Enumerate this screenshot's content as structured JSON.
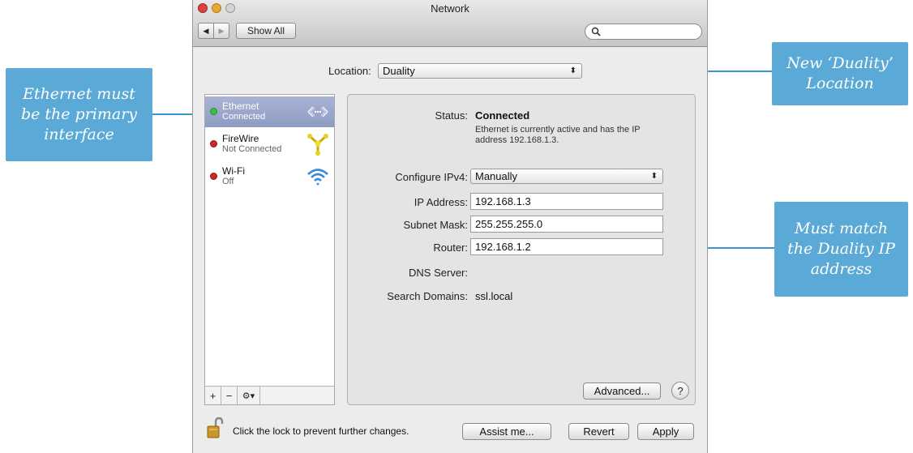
{
  "window": {
    "title": "Network",
    "show_all": "Show All"
  },
  "location": {
    "label": "Location:",
    "value": "Duality"
  },
  "services": [
    {
      "name": "Ethernet",
      "status": "Connected",
      "dot": "#3fbf3f",
      "icon": "ethernet-icon"
    },
    {
      "name": "FireWire",
      "status": "Not Connected",
      "dot": "#cc2a2a",
      "icon": "firewire-icon"
    },
    {
      "name": "Wi-Fi",
      "status": "Off",
      "dot": "#cc2a2a",
      "icon": "wifi-icon"
    }
  ],
  "sidebar_bar": {
    "add": "+",
    "remove": "−",
    "gear": "⚙▾"
  },
  "detail": {
    "status_label": "Status:",
    "status_value": "Connected",
    "status_desc_line1": "Ethernet is currently active and has the IP",
    "status_desc_line2": "address 192.168.1.3.",
    "ipv4_label": "Configure IPv4:",
    "ipv4_value": "Manually",
    "ip_label": "IP Address:",
    "ip_value": "192.168.1.3",
    "subnet_label": "Subnet Mask:",
    "subnet_value": "255.255.255.0",
    "router_label": "Router:",
    "router_value": "192.168.1.2",
    "dns_label": "DNS Server:",
    "search_label": "Search Domains:",
    "search_value": "ssl.local",
    "advanced": "Advanced...",
    "help": "?"
  },
  "footer": {
    "lock_text": "Click the lock to prevent further changes.",
    "assist": "Assist me...",
    "revert": "Revert",
    "apply": "Apply"
  },
  "callouts": {
    "primary": "Ethernet must\nbe the primary\ninterface",
    "location": "New ‘Duality’\nLocation",
    "router": "Must match\nthe Duality IP\naddress"
  },
  "colors": {
    "callout": "#5aa9d6",
    "selection": "#9aa6cc"
  }
}
